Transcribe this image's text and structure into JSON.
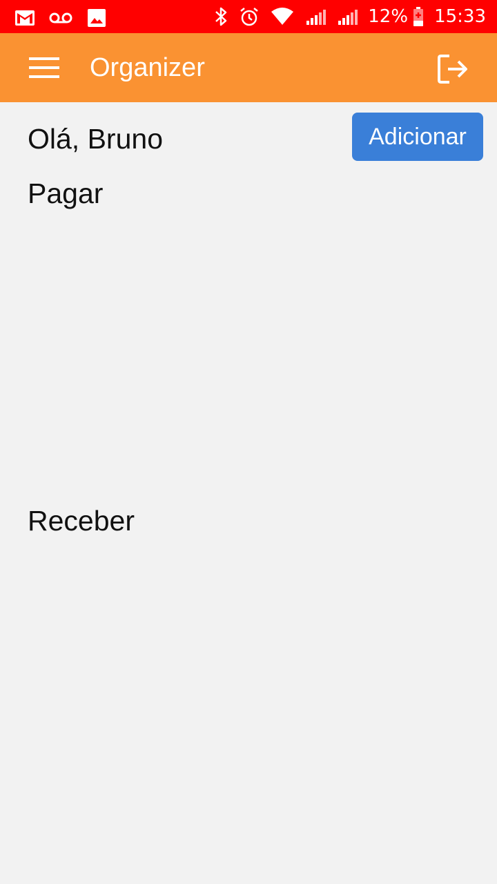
{
  "status_bar": {
    "battery": "12%",
    "time": "15:33",
    "icons_left": [
      "gmail-icon",
      "voicemail-icon",
      "image-icon"
    ],
    "icons_right": [
      "bluetooth-icon",
      "alarm-icon",
      "wifi-icon",
      "signal-icon",
      "signal-icon",
      "battery-charging-icon"
    ]
  },
  "app_bar": {
    "title": "Organizer",
    "menu_icon": "menu-icon",
    "logout_icon": "logout-icon"
  },
  "main": {
    "greeting": "Olá, Bruno",
    "add_button_label": "Adicionar",
    "sections": [
      {
        "title": "Pagar"
      },
      {
        "title": "Receber"
      }
    ]
  },
  "colors": {
    "status_bar": "#ff0000",
    "app_bar": "#fa9232",
    "primary_button": "#3a7fd8",
    "background": "#f2f2f2"
  }
}
